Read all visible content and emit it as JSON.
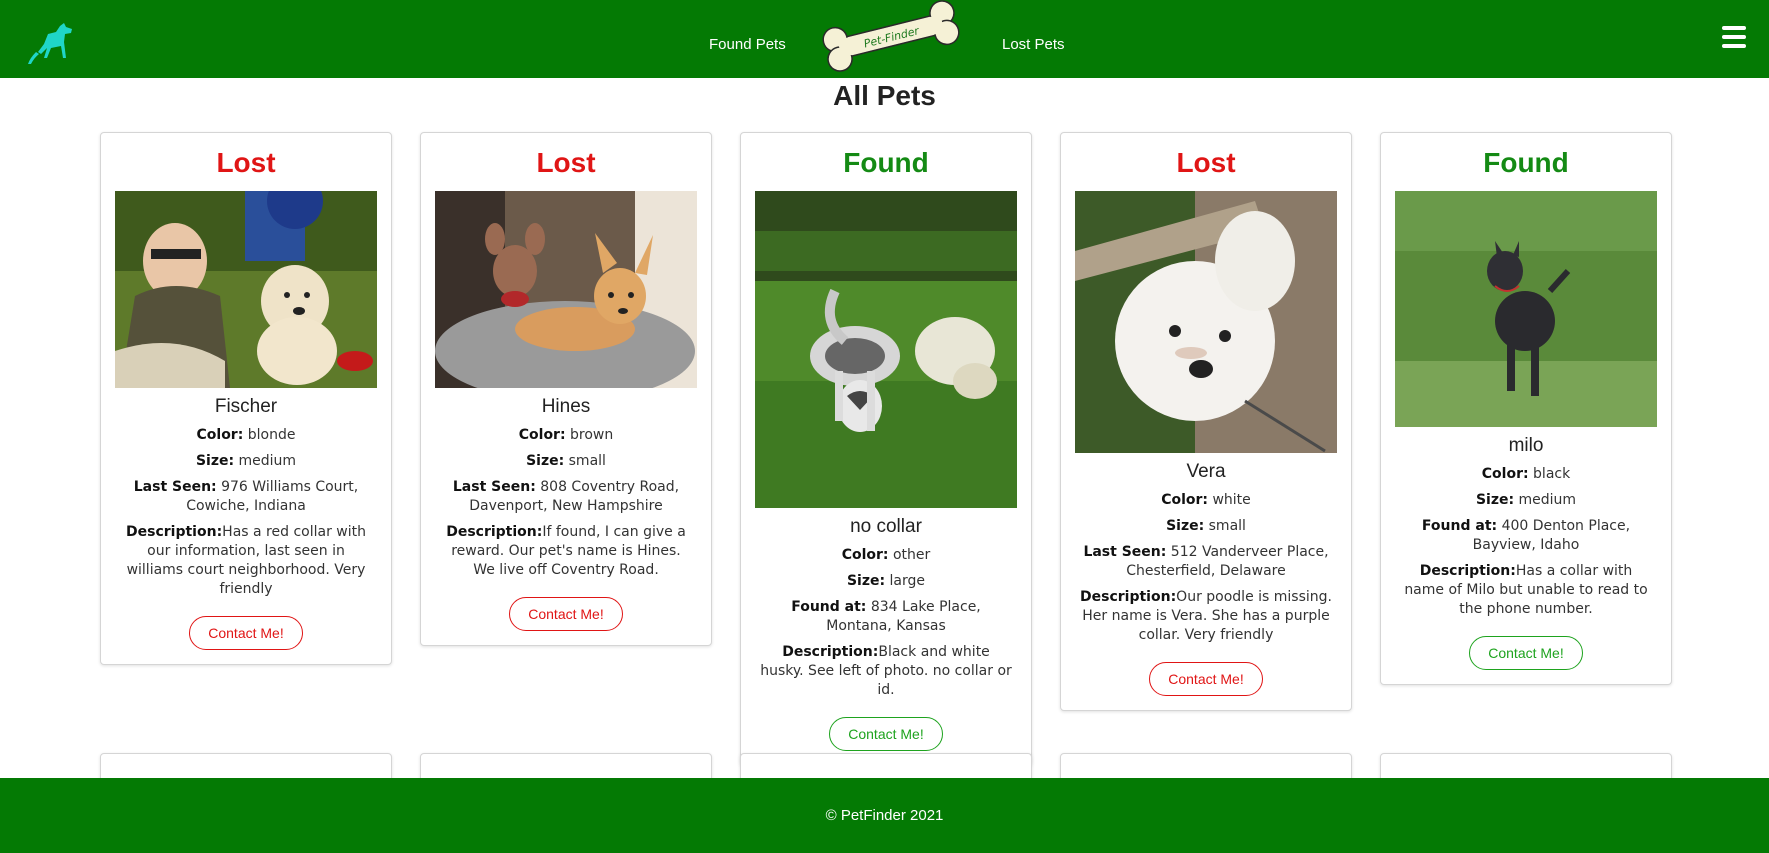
{
  "nav": {
    "found_label": "Found Pets",
    "lost_label": "Lost Pets",
    "logo_text": "Pet-Finder"
  },
  "page": {
    "title": "All Pets"
  },
  "cards": [
    {
      "status": "Lost",
      "name": "Fischer",
      "color_label": "Color:",
      "color": "blonde",
      "size_label": "Size:",
      "size": "medium",
      "location_label": "Last Seen:",
      "location": "976 Williams Court, Cowiche, Indiana",
      "description_label": "Description:",
      "description": "Has a red collar with our information, last seen in williams court neighborhood. Very friendly",
      "button": "Contact Me!"
    },
    {
      "status": "Lost",
      "name": "Hines",
      "color_label": "Color:",
      "color": "brown",
      "size_label": "Size:",
      "size": "small",
      "location_label": "Last Seen:",
      "location": "808 Coventry Road, Davenport, New Hampshire",
      "description_label": "Description:",
      "description": "If found, I can give a reward. Our pet's name is Hines. We live off Coventry Road.",
      "button": "Contact Me!"
    },
    {
      "status": "Found",
      "name": "no collar",
      "color_label": "Color:",
      "color": "other",
      "size_label": "Size:",
      "size": "large",
      "location_label": "Found at:",
      "location": "834 Lake Place, Montana, Kansas",
      "description_label": "Description:",
      "description": "Black and white husky. See left of photo. no collar or id.",
      "button": "Contact Me!"
    },
    {
      "status": "Lost",
      "name": "Vera",
      "color_label": "Color:",
      "color": "white",
      "size_label": "Size:",
      "size": "small",
      "location_label": "Last Seen:",
      "location": "512 Vanderveer Place, Chesterfield, Delaware",
      "description_label": "Description:",
      "description": "Our poodle is missing. Her name is Vera. She has a purple collar. Very friendly",
      "button": "Contact Me!"
    },
    {
      "status": "Found",
      "name": "milo",
      "color_label": "Color:",
      "color": "black",
      "size_label": "Size:",
      "size": "medium",
      "location_label": "Found at:",
      "location": "400 Denton Place, Bayview, Idaho",
      "description_label": "Description:",
      "description": "Has a collar with name of Milo but unable to read to the phone number.",
      "button": "Contact Me!"
    }
  ],
  "footer": {
    "text": "© PetFinder 2021"
  },
  "colors": {
    "nav": "#047a04",
    "lost": "#e01515",
    "found": "#148a14"
  }
}
